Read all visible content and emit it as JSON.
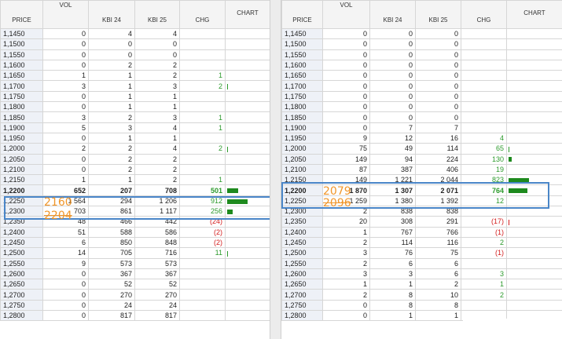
{
  "headers": {
    "price": "PRICE",
    "vol": "VOL",
    "kbi24": "KBI 24",
    "kbi25": "KBI 25",
    "chg": "CHG",
    "chart": "CHART"
  },
  "left": {
    "rows": [
      {
        "price": "1,1450",
        "vol": "0",
        "a": "4",
        "b": "4",
        "chg": "",
        "cls": "",
        "chart": 0,
        "tick": ""
      },
      {
        "price": "1,1500",
        "vol": "0",
        "a": "0",
        "b": "0",
        "chg": "",
        "cls": "",
        "chart": 0,
        "tick": ""
      },
      {
        "price": "1,1550",
        "vol": "0",
        "a": "0",
        "b": "0",
        "chg": "",
        "cls": "",
        "chart": 0,
        "tick": ""
      },
      {
        "price": "1,1600",
        "vol": "0",
        "a": "2",
        "b": "2",
        "chg": "",
        "cls": "",
        "chart": 0,
        "tick": ""
      },
      {
        "price": "1,1650",
        "vol": "1",
        "a": "1",
        "b": "2",
        "chg": "1",
        "cls": "pos",
        "chart": 0,
        "tick": ""
      },
      {
        "price": "1,1700",
        "vol": "3",
        "a": "1",
        "b": "3",
        "chg": "2",
        "cls": "pos",
        "chart": 0,
        "tick": "pos"
      },
      {
        "price": "1,1750",
        "vol": "0",
        "a": "1",
        "b": "1",
        "chg": "",
        "cls": "",
        "chart": 0,
        "tick": ""
      },
      {
        "price": "1,1800",
        "vol": "0",
        "a": "1",
        "b": "1",
        "chg": "",
        "cls": "",
        "chart": 0,
        "tick": ""
      },
      {
        "price": "1,1850",
        "vol": "3",
        "a": "2",
        "b": "3",
        "chg": "1",
        "cls": "pos",
        "chart": 0,
        "tick": ""
      },
      {
        "price": "1,1900",
        "vol": "5",
        "a": "3",
        "b": "4",
        "chg": "1",
        "cls": "pos",
        "chart": 0,
        "tick": ""
      },
      {
        "price": "1,1950",
        "vol": "0",
        "a": "1",
        "b": "1",
        "chg": "",
        "cls": "",
        "chart": 0,
        "tick": ""
      },
      {
        "price": "1,2000",
        "vol": "2",
        "a": "2",
        "b": "4",
        "chg": "2",
        "cls": "pos",
        "chart": 0,
        "tick": "pos"
      },
      {
        "price": "1,2050",
        "vol": "0",
        "a": "2",
        "b": "2",
        "chg": "",
        "cls": "",
        "chart": 0,
        "tick": ""
      },
      {
        "price": "1,2100",
        "vol": "0",
        "a": "2",
        "b": "2",
        "chg": "",
        "cls": "",
        "chart": 0,
        "tick": ""
      },
      {
        "price": "1,2150",
        "vol": "1",
        "a": "1",
        "b": "2",
        "chg": "1",
        "cls": "pos",
        "chart": 0,
        "tick": ""
      },
      {
        "price": "1,2200",
        "vol": "652",
        "a": "207",
        "b": "708",
        "chg": "501",
        "cls": "pos",
        "chart": 501,
        "tick": "",
        "bold": true
      },
      {
        "price": "1,2250",
        "vol": "1 564",
        "a": "294",
        "b": "1 206",
        "chg": "912",
        "cls": "pos",
        "chart": 912,
        "tick": ""
      },
      {
        "price": "1,2300",
        "vol": "703",
        "a": "861",
        "b": "1 117",
        "chg": "256",
        "cls": "pos",
        "chart": 256,
        "tick": ""
      },
      {
        "price": "1,2350",
        "vol": "48",
        "a": "466",
        "b": "442",
        "chg": "(24)",
        "cls": "neg",
        "chart": 0,
        "tick": ""
      },
      {
        "price": "1,2400",
        "vol": "51",
        "a": "588",
        "b": "586",
        "chg": "(2)",
        "cls": "neg",
        "chart": 0,
        "tick": ""
      },
      {
        "price": "1,2450",
        "vol": "6",
        "a": "850",
        "b": "848",
        "chg": "(2)",
        "cls": "neg",
        "chart": 0,
        "tick": ""
      },
      {
        "price": "1,2500",
        "vol": "14",
        "a": "705",
        "b": "716",
        "chg": "11",
        "cls": "pos",
        "chart": 0,
        "tick": "pos"
      },
      {
        "price": "1,2550",
        "vol": "9",
        "a": "573",
        "b": "573",
        "chg": "",
        "cls": "",
        "chart": 0,
        "tick": ""
      },
      {
        "price": "1,2600",
        "vol": "0",
        "a": "367",
        "b": "367",
        "chg": "",
        "cls": "",
        "chart": 0,
        "tick": ""
      },
      {
        "price": "1,2650",
        "vol": "0",
        "a": "52",
        "b": "52",
        "chg": "",
        "cls": "",
        "chart": 0,
        "tick": ""
      },
      {
        "price": "1,2700",
        "vol": "0",
        "a": "270",
        "b": "270",
        "chg": "",
        "cls": "",
        "chart": 0,
        "tick": ""
      },
      {
        "price": "1,2750",
        "vol": "0",
        "a": "24",
        "b": "24",
        "chg": "",
        "cls": "",
        "chart": 0,
        "tick": ""
      },
      {
        "price": "1,2800",
        "vol": "0",
        "a": "817",
        "b": "817",
        "chg": "",
        "cls": "",
        "chart": 0,
        "tick": ""
      }
    ],
    "annotations": [
      "2160",
      "2204"
    ]
  },
  "right": {
    "rows": [
      {
        "price": "1,1450",
        "vol": "0",
        "a": "0",
        "b": "0",
        "chg": "",
        "cls": "",
        "chart": 0,
        "tick": ""
      },
      {
        "price": "1,1500",
        "vol": "0",
        "a": "0",
        "b": "0",
        "chg": "",
        "cls": "",
        "chart": 0,
        "tick": ""
      },
      {
        "price": "1,1550",
        "vol": "0",
        "a": "0",
        "b": "0",
        "chg": "",
        "cls": "",
        "chart": 0,
        "tick": ""
      },
      {
        "price": "1,1600",
        "vol": "0",
        "a": "0",
        "b": "0",
        "chg": "",
        "cls": "",
        "chart": 0,
        "tick": ""
      },
      {
        "price": "1,1650",
        "vol": "0",
        "a": "0",
        "b": "0",
        "chg": "",
        "cls": "",
        "chart": 0,
        "tick": ""
      },
      {
        "price": "1,1700",
        "vol": "0",
        "a": "0",
        "b": "0",
        "chg": "",
        "cls": "",
        "chart": 0,
        "tick": ""
      },
      {
        "price": "1,1750",
        "vol": "0",
        "a": "0",
        "b": "0",
        "chg": "",
        "cls": "",
        "chart": 0,
        "tick": ""
      },
      {
        "price": "1,1800",
        "vol": "0",
        "a": "0",
        "b": "0",
        "chg": "",
        "cls": "",
        "chart": 0,
        "tick": ""
      },
      {
        "price": "1,1850",
        "vol": "0",
        "a": "0",
        "b": "0",
        "chg": "",
        "cls": "",
        "chart": 0,
        "tick": ""
      },
      {
        "price": "1,1900",
        "vol": "0",
        "a": "7",
        "b": "7",
        "chg": "",
        "cls": "",
        "chart": 0,
        "tick": ""
      },
      {
        "price": "1,1950",
        "vol": "9",
        "a": "12",
        "b": "16",
        "chg": "4",
        "cls": "pos",
        "chart": 0,
        "tick": ""
      },
      {
        "price": "1,2000",
        "vol": "75",
        "a": "49",
        "b": "114",
        "chg": "65",
        "cls": "pos",
        "chart": 0,
        "tick": "pos"
      },
      {
        "price": "1,2050",
        "vol": "149",
        "a": "94",
        "b": "224",
        "chg": "130",
        "cls": "pos",
        "chart": 130,
        "tick": ""
      },
      {
        "price": "1,2100",
        "vol": "87",
        "a": "387",
        "b": "406",
        "chg": "19",
        "cls": "pos",
        "chart": 0,
        "tick": ""
      },
      {
        "price": "1,2150",
        "vol": "149",
        "a": "1 221",
        "b": "2 044",
        "chg": "823",
        "cls": "pos",
        "chart": 823,
        "tick": ""
      },
      {
        "price": "1,2200",
        "vol": "1 870",
        "a": "1 307",
        "b": "2 071",
        "chg": "764",
        "cls": "pos",
        "chart": 764,
        "tick": "",
        "bold": true
      },
      {
        "price": "1,2250",
        "vol": "1 259",
        "a": "1 380",
        "b": "1 392",
        "chg": "12",
        "cls": "pos",
        "chart": 0,
        "tick": ""
      },
      {
        "price": "1,2300",
        "vol": "2",
        "a": "838",
        "b": "838",
        "chg": "",
        "cls": "",
        "chart": 0,
        "tick": ""
      },
      {
        "price": "1,2350",
        "vol": "20",
        "a": "308",
        "b": "291",
        "chg": "(17)",
        "cls": "neg",
        "chart": 0,
        "tick": "neg"
      },
      {
        "price": "1,2400",
        "vol": "1",
        "a": "767",
        "b": "766",
        "chg": "(1)",
        "cls": "neg",
        "chart": 0,
        "tick": ""
      },
      {
        "price": "1,2450",
        "vol": "2",
        "a": "114",
        "b": "116",
        "chg": "2",
        "cls": "pos",
        "chart": 0,
        "tick": ""
      },
      {
        "price": "1,2500",
        "vol": "3",
        "a": "76",
        "b": "75",
        "chg": "(1)",
        "cls": "neg",
        "chart": 0,
        "tick": ""
      },
      {
        "price": "1,2550",
        "vol": "2",
        "a": "6",
        "b": "6",
        "chg": "",
        "cls": "",
        "chart": 0,
        "tick": ""
      },
      {
        "price": "1,2600",
        "vol": "3",
        "a": "3",
        "b": "6",
        "chg": "3",
        "cls": "pos",
        "chart": 0,
        "tick": ""
      },
      {
        "price": "1,2650",
        "vol": "1",
        "a": "1",
        "b": "2",
        "chg": "1",
        "cls": "pos",
        "chart": 0,
        "tick": ""
      },
      {
        "price": "1,2700",
        "vol": "2",
        "a": "8",
        "b": "10",
        "chg": "2",
        "cls": "pos",
        "chart": 0,
        "tick": ""
      },
      {
        "price": "1,2750",
        "vol": "0",
        "a": "8",
        "b": "8",
        "chg": "",
        "cls": "",
        "chart": 0,
        "tick": ""
      },
      {
        "price": "1,2800",
        "vol": "0",
        "a": "1",
        "b": "1",
        "chg": "",
        "cls": "",
        "chart": 0,
        "tick": ""
      }
    ],
    "annotations": [
      "2079",
      "2096"
    ]
  },
  "colors": {
    "positive": "#2c9a2c",
    "negative": "#d42020",
    "bar": "#1e8a1e",
    "highlight_border": "#4a86c8",
    "annotation": "#f0962a"
  }
}
